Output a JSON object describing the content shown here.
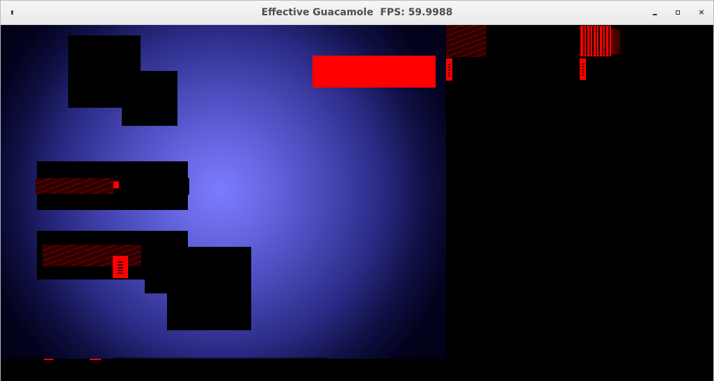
{
  "window": {
    "title": "Effective Guacamole",
    "fps_label": "FPS:",
    "fps_value": "59.9988",
    "title_separator": "  "
  },
  "icons": {
    "menu": "window-menu-icon",
    "minimize": "minimize-icon",
    "maximize": "maximize-icon",
    "close": "close-icon",
    "close_glyph": "×"
  },
  "colors": {
    "light_center": "#7b7bff",
    "shadow": "#000000",
    "hazard": "#ff0000",
    "hatch": "#5a0000"
  }
}
